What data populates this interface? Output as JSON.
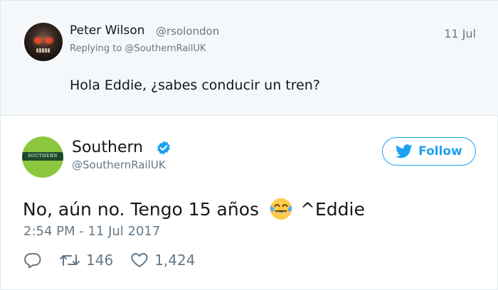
{
  "reply": {
    "name": "Peter Wilson",
    "handle": "@rsolondon",
    "date": "11 Jul",
    "replying_prefix": "Replying to ",
    "replying_to": "@SouthernRailUK",
    "text": "Hola Eddie, ¿sabes conducir un tren?"
  },
  "tweet": {
    "name": "Southern",
    "handle": "@SouthernRailUK",
    "avatar_text": "SOUTHERN",
    "follow_label": "Follow",
    "text_before": "No, aún no. Tengo 15 años",
    "text_after": "^Eddie",
    "emoji": "face-with-tears-of-joy",
    "timestamp": "2:54 PM - 11 Jul 2017",
    "retweets": "146",
    "likes": "1,424"
  },
  "colors": {
    "accent": "#1da1f2",
    "muted": "#657786",
    "reply_background": "#f5f8fa",
    "southern_green": "#8dc63f",
    "southern_dark": "#1d4a2a"
  }
}
